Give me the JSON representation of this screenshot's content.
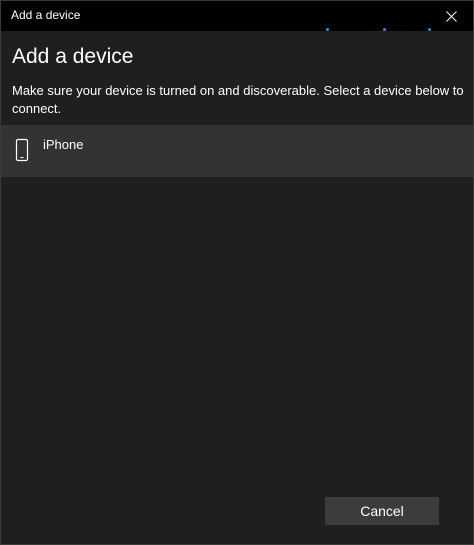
{
  "window": {
    "title": "Add a device"
  },
  "header": {
    "heading": "Add a device",
    "description": "Make sure your device is turned on and discoverable. Select a device below to connect."
  },
  "devices": [
    {
      "name": "iPhone",
      "icon": "phone-icon"
    }
  ],
  "footer": {
    "cancel_label": "Cancel"
  },
  "colors": {
    "accent": "#2a8fe6",
    "background": "#1f1f1f",
    "titlebar": "#000000",
    "selected_item": "#333333"
  },
  "icons": {
    "close": "close-icon",
    "device": "phone-icon"
  }
}
